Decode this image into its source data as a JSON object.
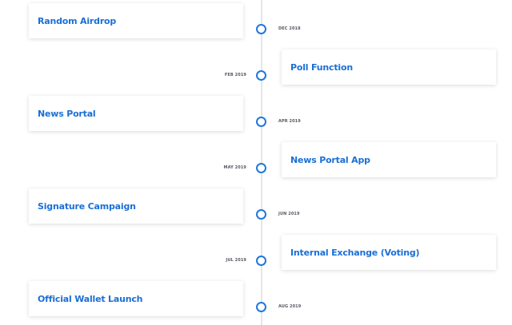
{
  "timeline": {
    "items": [
      {
        "title": "Random Airdrop",
        "date": "DEC 2018"
      },
      {
        "title": "Poll Function",
        "date": "FEB 2019"
      },
      {
        "title": "News Portal",
        "date": "APR 2019"
      },
      {
        "title": "News Portal App",
        "date": "MAY 2019"
      },
      {
        "title": "Signature Campaign",
        "date": "JUN 2019"
      },
      {
        "title": "Internal Exchange (Voting)",
        "date": "JUL 2019"
      },
      {
        "title": "Official Wallet Launch",
        "date": "AUG 2019"
      }
    ]
  },
  "colors": {
    "accent": "#1b6fd6",
    "dot_border": "#1f78dc",
    "axis": "#e6e6e6",
    "date_text": "#555a63"
  }
}
